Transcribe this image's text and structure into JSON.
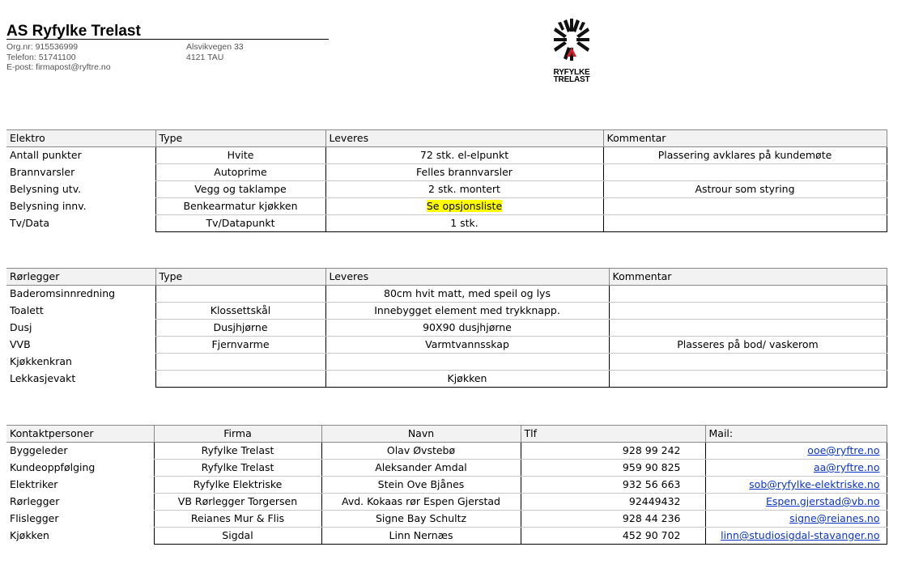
{
  "header": {
    "company": "AS Ryfylke Trelast",
    "orgnr": "Org.nr: 915536999",
    "phone": "Telefon: 51741100",
    "email": "E-post: firmapost@ryftre.no",
    "street": "Alsvikvegen 33",
    "city": "4121 TAU",
    "logo_line1": "RYFYLKE",
    "logo_line2": "TRELAST"
  },
  "elektro": {
    "headers": [
      "Elektro",
      "Type",
      "Leveres",
      "Kommentar"
    ],
    "rows": [
      [
        "Antall punkter",
        "Hvite",
        "72 stk. el-elpunkt",
        "Plassering avklares på kundemøte"
      ],
      [
        "Brannvarsler",
        "Autoprime",
        "Felles brannvarsler",
        ""
      ],
      [
        "Belysning utv.",
        "Vegg og taklampe",
        "2 stk. montert",
        "Astrour som styring"
      ],
      [
        "Belysning innv.",
        "Benkearmatur kjøkken",
        "Se opsjonsliste",
        ""
      ],
      [
        "Tv/Data",
        "Tv/Datapunkt",
        "1 stk.",
        ""
      ]
    ]
  },
  "rorlegger": {
    "headers": [
      "Rørlegger",
      "Type",
      "Leveres",
      "Kommentar"
    ],
    "rows": [
      [
        "Baderomsinnredning",
        "",
        "80cm hvit matt, med speil og lys",
        ""
      ],
      [
        "Toalett",
        "Klossettskål",
        "Innebygget element med trykknapp.",
        ""
      ],
      [
        "Dusj",
        "Dusjhjørne",
        "90X90 dusjhjørne",
        ""
      ],
      [
        "VVB",
        "Fjernvarme",
        "Varmtvannsskap",
        "Plasseres på bod/ vaskerom"
      ],
      [
        "Kjøkkenkran",
        "",
        "",
        ""
      ],
      [
        "Lekkasjevakt",
        "",
        "Kjøkken",
        ""
      ]
    ]
  },
  "kontakt": {
    "headers": [
      "Kontaktpersoner",
      "Firma",
      "Navn",
      "Tlf",
      "Mail:"
    ],
    "rows": [
      [
        "Byggeleder",
        "Ryfylke Trelast",
        "Olav Øvstebø",
        "928 99 242",
        "ooe@ryftre.no"
      ],
      [
        "Kundeoppfølging",
        "Ryfylke Trelast",
        "Aleksander Amdal",
        "959 90 825",
        "aa@ryftre.no"
      ],
      [
        "Elektriker",
        "Ryfylke Elektriske",
        "Stein Ove Bjånes",
        "932 56 663",
        "sob@ryfylke-elektriske.no"
      ],
      [
        "Rørlegger",
        "VB Rørlegger Torgersen",
        "Avd. Kokaas rør Espen Gjerstad",
        "92449432",
        "Espen.gjerstad@vb.no"
      ],
      [
        "Flislegger",
        "Reianes Mur & Flis",
        "Signe Bay Schultz",
        "928 44 236",
        "signe@reianes.no"
      ],
      [
        "Kjøkken",
        "Sigdal",
        "Linn Nernæs",
        "452 90 702",
        "linn@studiosigdal-stavanger.no"
      ]
    ]
  },
  "colors": {
    "highlight": "#ffff00",
    "link": "#0b35c4",
    "header_bg": "#f2f2f2"
  }
}
